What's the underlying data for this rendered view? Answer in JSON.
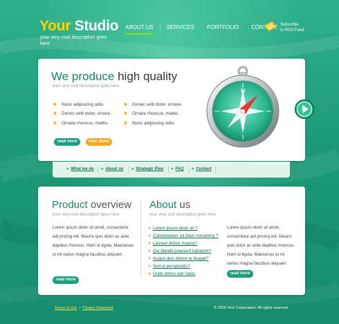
{
  "brand": {
    "logo_part1": "Your",
    "logo_part2": "Studio",
    "tagline": "your very cool description goes here"
  },
  "nav": {
    "items": [
      "ABOUT US",
      "SERVICES",
      "PORTFOLIO",
      "CONTACT"
    ],
    "active": "ABOUT US"
  },
  "rss": {
    "line1": "Subscribe",
    "line2": "to RSS Feed"
  },
  "hero": {
    "title_bold": "We produce",
    "title_rest": " high quality",
    "subtitle": "your very cool description goes here",
    "bullets_left": [
      "Nunc adipiscing odio.",
      "Donec velit dolor, ornare.",
      "Ornare rhoncus, mattis."
    ],
    "bullets_right": [
      "Donec velit dolor, ornare.",
      "Ornare rhoncus, mattis.",
      "Nunc adipiscing odio."
    ],
    "read_more": "read more",
    "view_demo": "view demo"
  },
  "subnav": {
    "items": [
      "What we do",
      "About us",
      "Strategic Plan",
      "FAQ",
      "Contact"
    ]
  },
  "product": {
    "title_bold": "Product",
    "title_rest": " overview",
    "subtitle": "your very cool description goes here",
    "text": "Lorem ipsum dolor sit amet, consectetur adi pricing elit. Mauris quis dolor ac ante dapibus rhoncus. Ham ut ligula. Maecenas ut mi varius magna faucibus aliquam.",
    "read_more": "read more"
  },
  "about": {
    "title_bold": "About",
    "title_rest": " us",
    "subtitle": "your very cool description goes here",
    "links": [
      "Lorem ipsum dolor sit ?",
      "Consectetuer ed diam nonummy ?",
      "Laoreet dolore magna?",
      "Qui blandit praesent luptatum?",
      "Augue duis dolore te feugait?",
      "Sed ut perspiciatis?",
      "Unde omnis iste natus"
    ],
    "text": "Lorem ipsum dolor sit amet, consectetur adi pricing elit. Mauris quis dolor ac ante dapibus rhoncus. Ham ut ligula. Maecenas ut mi varius magna faucibus aliquam.",
    "read_more": "read more"
  },
  "footer": {
    "terms": "Terms of Use",
    "separator": "|",
    "privacy": "Privacy Statement",
    "copyright": "© 2009 Your Corporation. All rights reserved"
  },
  "colors": {
    "brand_green": "#158a64",
    "accent_yellow": "#ffd400",
    "accent_orange": "#f5a623",
    "nav_active": "#8be000"
  },
  "icons": {
    "rss": "rss-tag-icon",
    "compass": "compass-icon",
    "next": "next-arrow-icon"
  }
}
